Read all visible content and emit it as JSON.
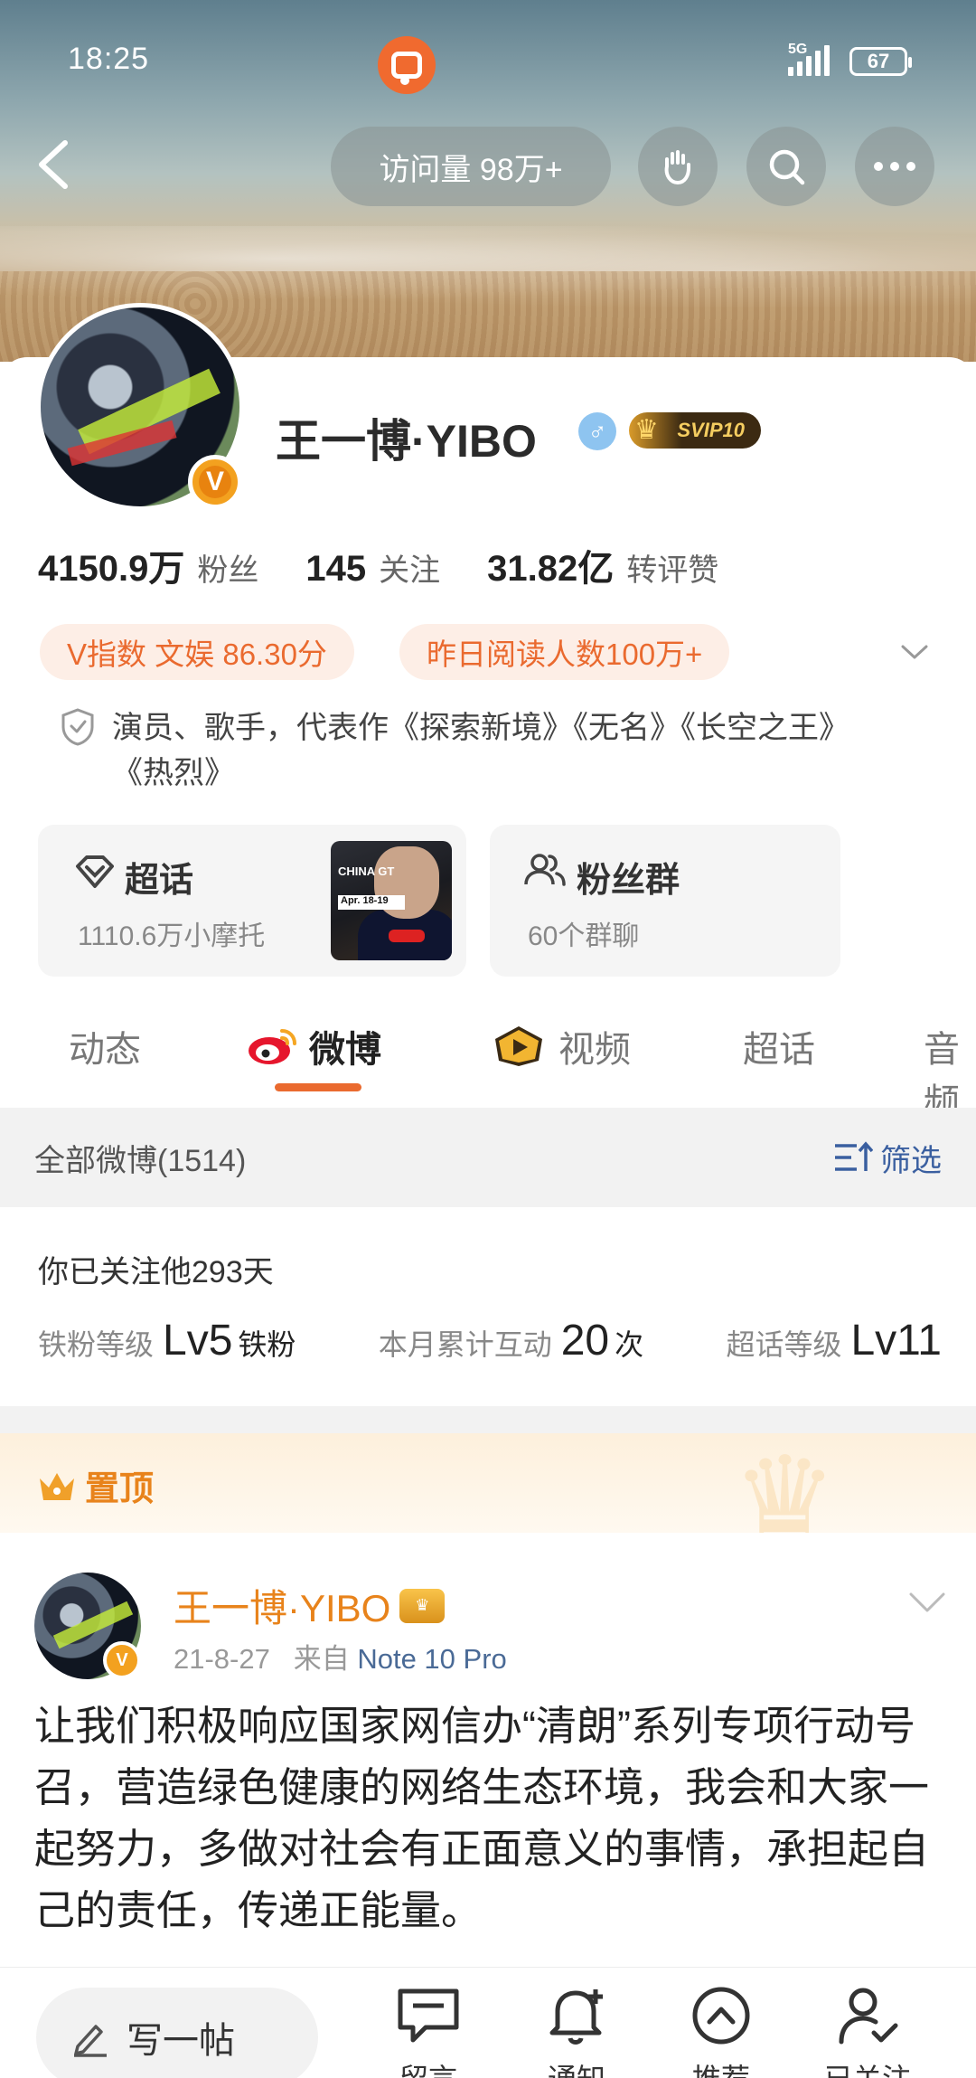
{
  "status_bar": {
    "time": "18:25",
    "network": "5G",
    "battery": "67"
  },
  "header": {
    "visit_count": "访问量 98万+"
  },
  "profile": {
    "name": "王一博·YIBO",
    "gender_symbol": "♂",
    "vip_badge": "SVIP10",
    "verified_badge": "V",
    "stats": [
      {
        "value": "4150.9万",
        "label": "粉丝"
      },
      {
        "value": "145",
        "label": "关注"
      },
      {
        "value": "31.82亿",
        "label": "转评赞"
      }
    ],
    "tags": [
      "V指数 文娱 86.30分",
      "昨日阅读人数100万+"
    ],
    "bio_line1": "演员、歌手，代表作《探索新境》《无名》《长空之王》",
    "bio_line2": "《热烈》"
  },
  "features": {
    "supertopic": {
      "title": "超话",
      "subtitle": "1110.6万小摩托",
      "thumb_text_1": "CHINA GT",
      "thumb_text_2": "Apr. 18-19"
    },
    "fan_group": {
      "title": "粉丝群",
      "subtitle": "60个群聊"
    }
  },
  "tabs": [
    "动态",
    "微博",
    "视频",
    "超话",
    "音频"
  ],
  "feed": {
    "all_label": "全部微博(1514)",
    "filter_label": "筛选"
  },
  "follow_info": {
    "days": "你已关注他293天",
    "stats": [
      {
        "key": "铁粉等级",
        "value": "Lv5",
        "unit": "铁粉"
      },
      {
        "key": "本月累计互动",
        "value": "20",
        "unit": "次"
      },
      {
        "key": "超话等级",
        "value": "Lv11",
        "unit": ""
      }
    ]
  },
  "pinned": {
    "label": "置顶"
  },
  "post": {
    "author": "王一博·YIBO",
    "date": "21-8-27",
    "source_prefix": "来自",
    "source": "Note 10 Pro",
    "text": "让我们积极响应国家网信办“清朗”系列专项行动号召，营造绿色健康的网络生态环境，我会和大家一起努力，多做对社会有正面意义的事情，承担起自己的责任，传递正能量。"
  },
  "bottom_bar": {
    "compose": "写一帖",
    "items": [
      "留言",
      "通知",
      "推荐",
      "已关注"
    ]
  },
  "colors": {
    "accent": "#ea6a2f",
    "link": "#3a5fa0",
    "vip_gold": "#e8831b"
  }
}
